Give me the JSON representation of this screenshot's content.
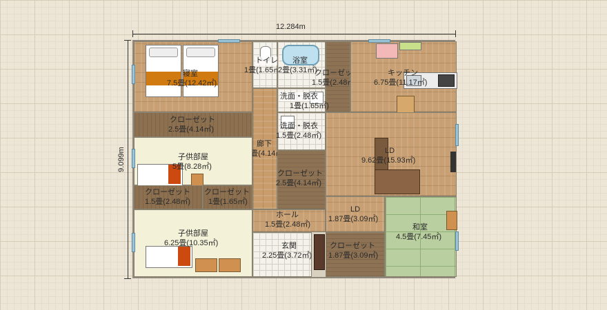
{
  "dimensions": {
    "width_label": "12.284m",
    "height_label": "9.099m"
  },
  "rooms": {
    "bedroom": {
      "name": "寝室",
      "size": "7.5畳(12.42㎡)"
    },
    "toilet": {
      "name": "トイレ",
      "size": "1畳(1.65㎡)"
    },
    "bath": {
      "name": "浴室",
      "size": "2畳(3.31㎡)"
    },
    "closet_top": {
      "name": "クローゼット",
      "size": "1.5畳(2.48㎡)"
    },
    "kitchen": {
      "name": "キッチン",
      "size": "6.75畳(11.17㎡)"
    },
    "washroom1": {
      "name": "洗面・脱衣",
      "size": "1畳(1.65㎡)"
    },
    "closet_bed": {
      "name": "クローゼット",
      "size": "2.5畳(4.14㎡)"
    },
    "washroom2": {
      "name": "洗面・脱衣",
      "size": "1.5畳(2.48㎡)"
    },
    "corridor": {
      "name": "廊下",
      "size": "2.5畳(4.14㎡)"
    },
    "kids1": {
      "name": "子供部屋",
      "size": "5畳(8.28㎡)"
    },
    "ld_main": {
      "name": "LD",
      "size": "9.62畳(15.93㎡)"
    },
    "closet_mid": {
      "name": "クローゼット",
      "size": "2.5畳(4.14㎡)"
    },
    "closet_k1": {
      "name": "クローゼット",
      "size": "1.5畳(2.48㎡)"
    },
    "closet_k2": {
      "name": "クローゼット",
      "size": "1畳(1.65㎡)"
    },
    "ld_small": {
      "name": "LD",
      "size": "1.87畳(3.09㎡)"
    },
    "hall": {
      "name": "ホール",
      "size": "1.5畳(2.48㎡)"
    },
    "washitsu": {
      "name": "和室",
      "size": "4.5畳(7.45㎡)"
    },
    "kids2": {
      "name": "子供部屋",
      "size": "6.25畳(10.35㎡)"
    },
    "entrance": {
      "name": "玄関",
      "size": "2.25畳(3.72㎡)"
    },
    "closet_bottom": {
      "name": "クローゼット",
      "size": "1.87畳(3.09㎡)"
    }
  },
  "colors": {
    "grid": "#d7ccb8",
    "wall": "#9a9385",
    "window": "#9bc4d6"
  }
}
